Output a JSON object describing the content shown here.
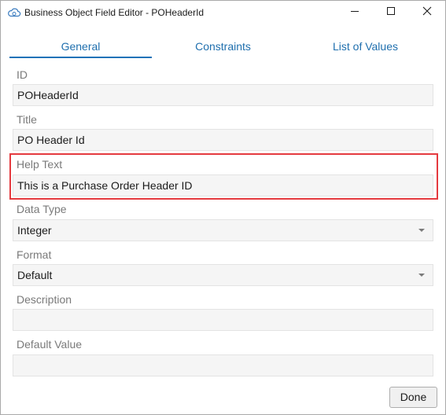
{
  "window": {
    "title": "Business Object Field Editor - POHeaderId",
    "app_icon": "cloud-gear-icon",
    "controls": [
      "minimize-icon",
      "maximize-icon",
      "close-icon"
    ]
  },
  "tabs": [
    {
      "label": "General",
      "active": true
    },
    {
      "label": "Constraints",
      "active": false
    },
    {
      "label": "List of Values",
      "active": false
    }
  ],
  "fields": {
    "id": {
      "label": "ID",
      "value": "POHeaderId"
    },
    "title": {
      "label": "Title",
      "value": "PO Header Id"
    },
    "help_text": {
      "label": "Help Text",
      "value": "This is a Purchase Order Header ID"
    },
    "data_type": {
      "label": "Data Type",
      "value": "Integer"
    },
    "format": {
      "label": "Format",
      "value": "Default"
    },
    "description": {
      "label": "Description",
      "value": ""
    },
    "default_value": {
      "label": "Default Value",
      "value": ""
    }
  },
  "footer": {
    "done_label": "Done"
  },
  "colors": {
    "accent": "#1f72b8",
    "highlight": "#e53a3f"
  }
}
